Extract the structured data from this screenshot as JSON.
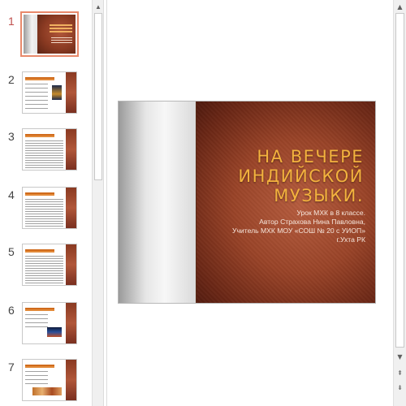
{
  "thumbnails": [
    {
      "number": "1",
      "selected": true
    },
    {
      "number": "2",
      "selected": false
    },
    {
      "number": "3",
      "selected": false
    },
    {
      "number": "4",
      "selected": false
    },
    {
      "number": "5",
      "selected": false
    },
    {
      "number": "6",
      "selected": false
    },
    {
      "number": "7",
      "selected": false
    }
  ],
  "slide": {
    "title_lines": [
      "НА ВЕЧЕРЕ",
      "ИНДИЙСКОЙ",
      "МУЗЫКИ."
    ],
    "subtitle_lines": [
      "Урок   МХК в 8 классе.",
      "Автор  Страхова Нина Павловна,",
      "Учитель МХК  МОУ «СОШ № 20 с УИОП»",
      "г.Ухта РК"
    ]
  },
  "scrollbars": {
    "up_icon": "▲",
    "down_icon": "▼",
    "prev_slide_icon": "⇞",
    "next_slide_icon": "⇟"
  },
  "colors": {
    "selected_border": "#e8896b",
    "selected_number": "#c0504d",
    "title_color": "#f3b23e",
    "slide_background": "#9a4428"
  }
}
